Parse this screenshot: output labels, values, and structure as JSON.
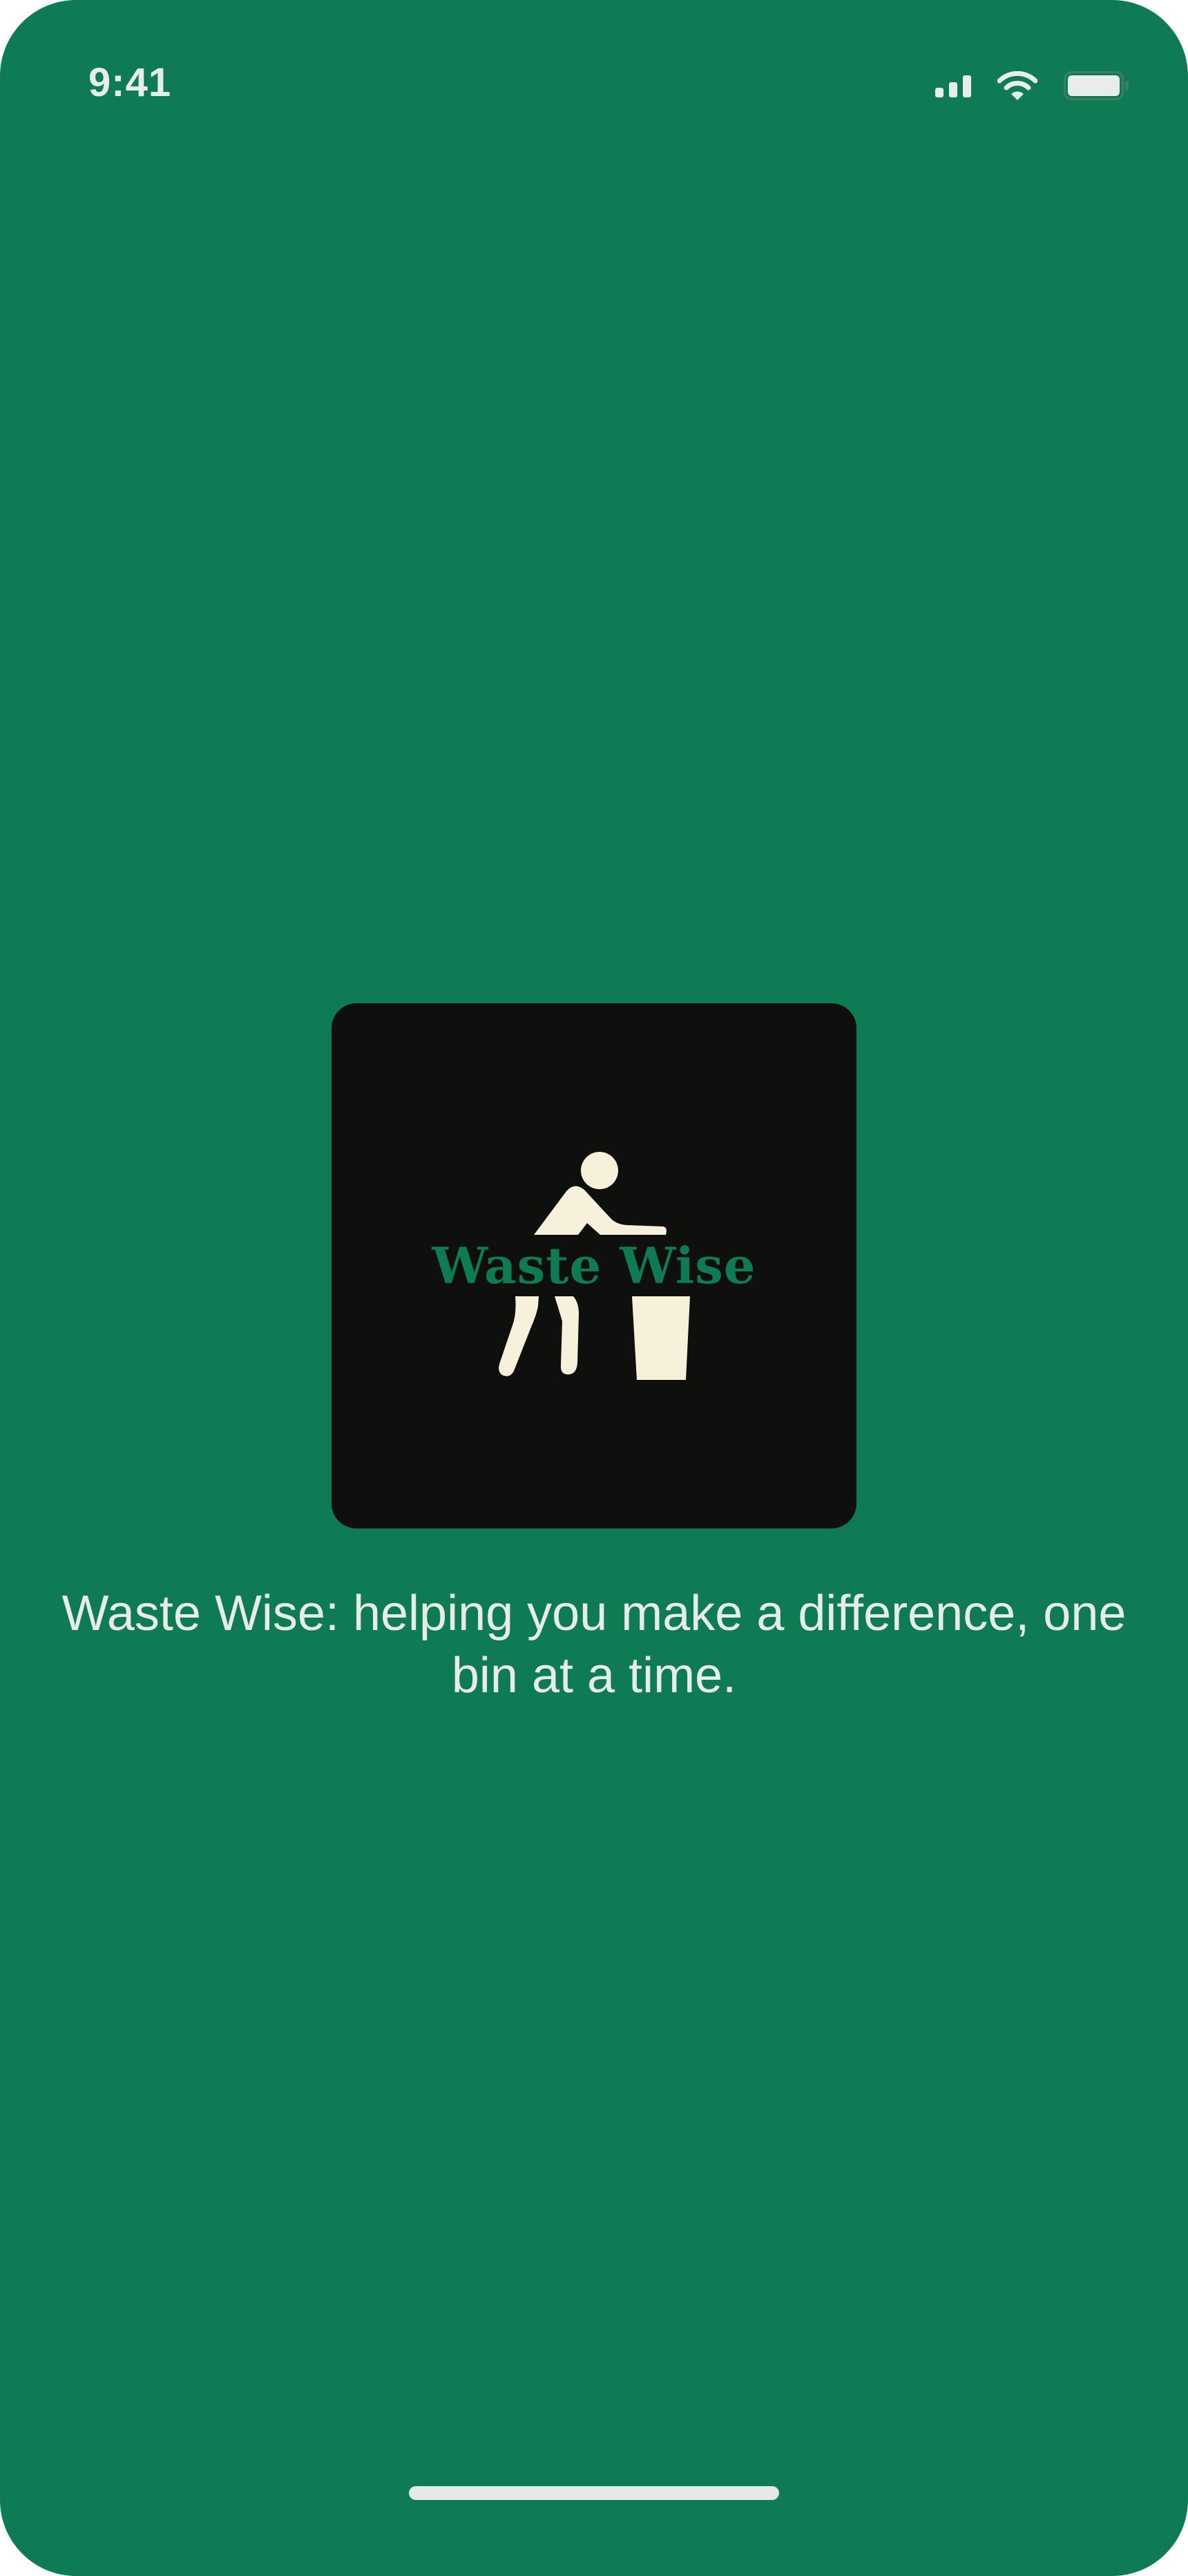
{
  "status_bar": {
    "time": "9:41"
  },
  "logo": {
    "wordmark": "Waste Wise",
    "icon": "person-tossing-trash-into-bin-icon"
  },
  "tagline": "Waste Wise: helping you make a difference, one bin at a time.",
  "colors": {
    "background": "#0f7b55",
    "logo_card": "#0f0f0d",
    "logo_figure": "#f7f1dc",
    "text": "#e6ece9"
  }
}
